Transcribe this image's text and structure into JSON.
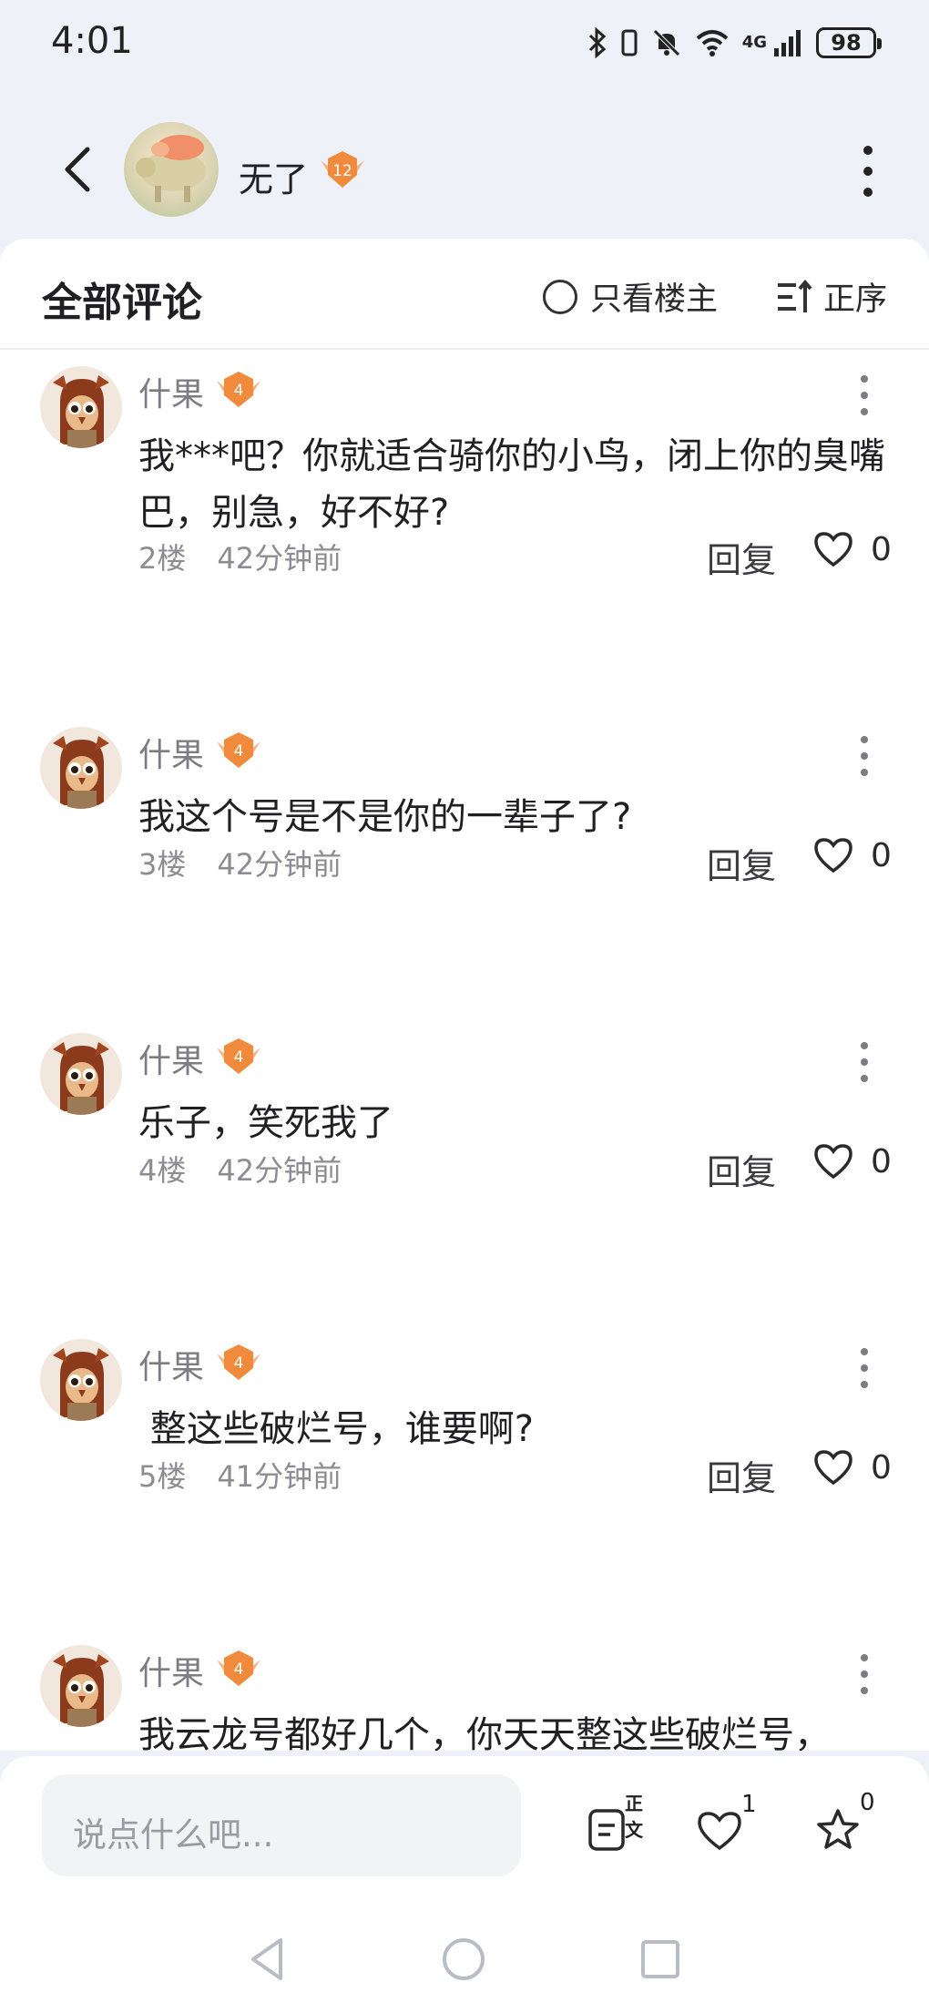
{
  "status": {
    "time": "4:01",
    "battery": "98",
    "network": "4G"
  },
  "header": {
    "owner_name": "无了",
    "owner_level": "12"
  },
  "comments_header": {
    "title": "全部评论",
    "only_owner": "只看楼主",
    "sort": "正序"
  },
  "comments": [
    {
      "user": "什果",
      "level": "4",
      "text": "我***吧？你就适合骑你的小鸟，闭上你的臭嘴巴，别急，好不好?",
      "floor": "2楼",
      "time": "42分钟前",
      "reply": "回复",
      "likes": "0"
    },
    {
      "user": "什果",
      "level": "4",
      "text": "我这个号是不是你的一辈子了?",
      "floor": "3楼",
      "time": "42分钟前",
      "reply": "回复",
      "likes": "0"
    },
    {
      "user": "什果",
      "level": "4",
      "text": "乐子，笑死我了",
      "floor": "4楼",
      "time": "42分钟前",
      "reply": "回复",
      "likes": "0"
    },
    {
      "user": "什果",
      "level": "4",
      "text": " 整这些破烂号，谁要啊?",
      "floor": "5楼",
      "time": "41分钟前",
      "reply": "回复",
      "likes": "0"
    },
    {
      "user": "什果",
      "level": "4",
      "text": "我云龙号都好几个，你天天整这些破烂号，"
    }
  ],
  "bottom_bar": {
    "input_placeholder": "说点什么吧...",
    "post_label": "正文",
    "like_count": "1",
    "fav_count": "0"
  },
  "colors": {
    "background": "#eef2f8",
    "card": "#ffffff",
    "level_badge": "#f08a3c",
    "text_primary": "#1f1f24",
    "text_secondary": "#8c8c92"
  }
}
